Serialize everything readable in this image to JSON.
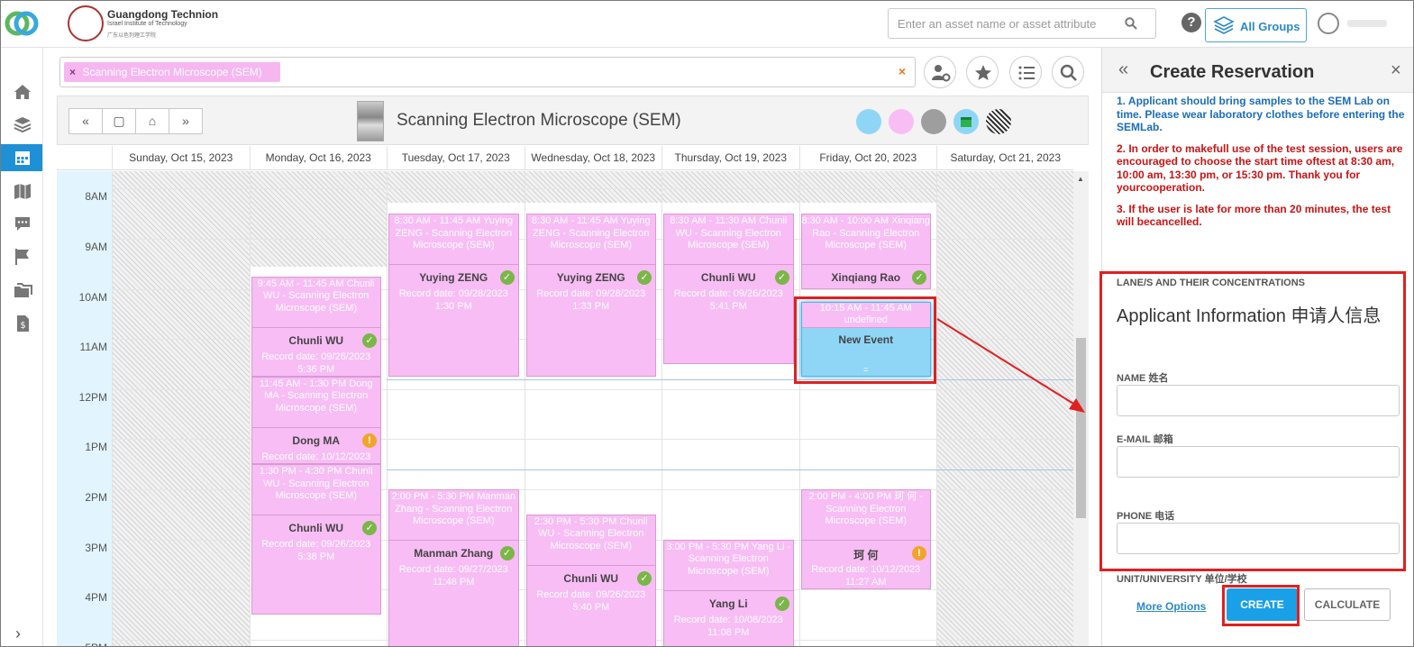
{
  "org": {
    "name": "Guangdong Technion",
    "subtitle": "Israel Institute of Technology",
    "chinese": "广东以色列理工学院"
  },
  "search": {
    "placeholder": "Enter an asset name or asset attribute"
  },
  "header": {
    "groups_label": "All Groups",
    "help": "?"
  },
  "filter": {
    "chip_label": "Scanning Electron Microscope (SEM)",
    "chip_remove": "×",
    "clear": "×"
  },
  "calendar": {
    "asset_title": "Scanning Electron Microscope (SEM)",
    "nav": {
      "prev": "«",
      "today": "▢",
      "home": "⌂",
      "next": "»"
    },
    "days": [
      "Sunday, Oct 15, 2023",
      "Monday, Oct 16, 2023",
      "Tuesday, Oct 17, 2023",
      "Wednesday, Oct 18, 2023",
      "Thursday, Oct 19, 2023",
      "Friday, Oct 20, 2023",
      "Saturday, Oct 21, 2023"
    ],
    "times": [
      "8AM",
      "9AM",
      "10AM",
      "11AM",
      "12PM",
      "1PM",
      "2PM",
      "3PM",
      "4PM",
      "5PM"
    ],
    "legend_colors": [
      "#8fd6f6",
      "#f8bdf5",
      "#9e9e9e",
      "#8fd6f6",
      "hatched"
    ],
    "events": [
      {
        "day": 1,
        "start": 9.75,
        "end": 11.75,
        "head": "9:45 AM - 11:45 AM Chunli WU - Scanning Electron Microscope (SEM)",
        "name": "Chunli WU",
        "record": "Record date: 09/26/2023 5:36 PM",
        "status": "ok"
      },
      {
        "day": 1,
        "start": 11.75,
        "end": 13.5,
        "head": "11:45 AM - 1:30 PM Dong MA - Scanning Electron Microscope (SEM)",
        "name": "Dong MA",
        "record": "Record date: 10/12/2023",
        "status": "warn"
      },
      {
        "day": 1,
        "start": 13.5,
        "end": 16.5,
        "head": "1:30 PM - 4:30 PM Chunli WU - Scanning Electron Microscope (SEM)",
        "name": "Chunli WU",
        "record": "Record date: 09/26/2023 5:38 PM",
        "status": "ok"
      },
      {
        "day": 2,
        "start": 8.5,
        "end": 11.75,
        "head": "8:30 AM - 11:45 AM Yuying ZENG - Scanning Electron Microscope (SEM)",
        "name": "Yuying ZENG",
        "record": "Record date: 09/28/2023 1:30 PM",
        "status": "ok"
      },
      {
        "day": 2,
        "start": 14,
        "end": 17.5,
        "head": "2:00 PM - 5:30 PM Manman Zhang - Scanning Electron Microscope (SEM)",
        "name": "Manman Zhang",
        "record": "Record date: 09/27/2023 11:48 PM",
        "status": "ok"
      },
      {
        "day": 3,
        "start": 8.5,
        "end": 11.75,
        "head": "8:30 AM - 11:45 AM Yuying ZENG - Scanning Electron Microscope (SEM)",
        "name": "Yuying ZENG",
        "record": "Record date: 09/28/2023 1:33 PM",
        "status": "ok"
      },
      {
        "day": 3,
        "start": 14.5,
        "end": 17.5,
        "head": "2:30 PM - 5:30 PM Chunli WU - Scanning Electron Microscope (SEM)",
        "name": "Chunli WU",
        "record": "Record date: 09/26/2023 5:40 PM",
        "status": "ok"
      },
      {
        "day": 4,
        "start": 8.5,
        "end": 11.5,
        "head": "8:30 AM - 11:30 AM Chunli WU - Scanning Electron Microscope (SEM)",
        "name": "Chunli WU",
        "record": "Record date: 09/26/2023 5:41 PM",
        "status": "ok"
      },
      {
        "day": 4,
        "start": 15,
        "end": 17.5,
        "head": "3:00 PM - 5:30 PM Yang Li - Scanning Electron Microscope (SEM)",
        "name": "Yang Li",
        "record": "Record date: 10/08/2023 11:08 PM",
        "status": "ok"
      },
      {
        "day": 5,
        "start": 8.5,
        "end": 10,
        "head": "8:30 AM - 10:00 AM Xinqiang Rao - Scanning Electron Microscope (SEM)",
        "name": "Xinqiang Rao",
        "record": "",
        "status": "ok"
      },
      {
        "day": 5,
        "start": 14,
        "end": 16,
        "head": "2:00 PM - 4:00 PM 珂 何 - Scanning Electron Microscope (SEM)",
        "name": "珂 何",
        "record": "Record date: 10/12/2023 11:27 AM",
        "status": "warn"
      }
    ],
    "new_event": {
      "day": 5,
      "start": 10.25,
      "end": 11.75,
      "head": "10:15 AM - 11:45 AM undefined",
      "name": "New Event"
    }
  },
  "panel": {
    "title": "Create Reservation",
    "collapse": "«",
    "close": "×",
    "notes": [
      {
        "text": "1. Applicant should bring samples to the SEM Lab on time.  Please wear laboratory clothes before  entering the SEMLab.",
        "color": "blue"
      },
      {
        "text": "2. In order to makefull use of the test session, users are encouraged to choose the start time oftest at 8:30 am, 10:00 am, 13:30 pm, or 15:30 pm. Thank you for yourcooperation.",
        "color": "red"
      },
      {
        "text": "3. If the user is late for more than 20 minutes, the test will becancelled.",
        "color": "red"
      }
    ],
    "lane_label": "LANE/S AND THEIR CONCENTRATIONS",
    "applicant_title": "Applicant Information 申请人信息",
    "fields": [
      {
        "label": "NAME 姓名",
        "value": ""
      },
      {
        "label": "E-MAIL 邮箱",
        "value": ""
      },
      {
        "label": "PHONE 电话",
        "value": ""
      }
    ],
    "unit_label": "UNIT/UNIVERSITY 单位/学校",
    "more_options": "More Options",
    "create": "CREATE",
    "calculate": "CALCULATE"
  }
}
